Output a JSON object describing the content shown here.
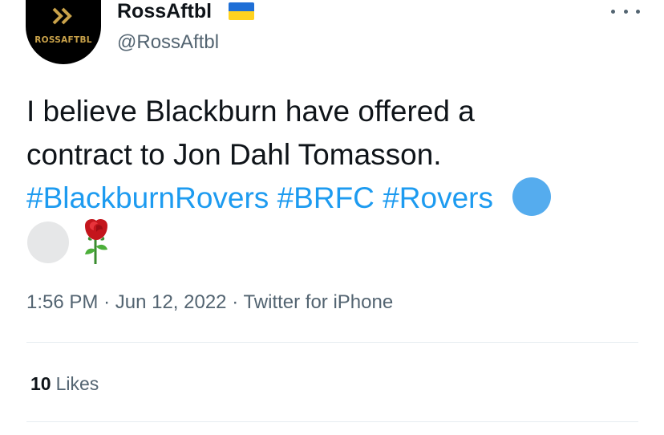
{
  "author": {
    "display_name": "RossAftbl",
    "handle": "@RossAftbl",
    "avatar_text": "ROSSAFTBL",
    "flag_icon": "ukraine-flag-icon"
  },
  "more_icon": "more-options-icon",
  "tweet": {
    "line1": "I believe Blackburn have offered a",
    "line2": "contract to Jon Dahl Tomasson.",
    "hashtags": [
      "#BlackburnRovers",
      "#BRFC",
      "#Rovers"
    ],
    "emojis": [
      "blue-circle-icon",
      "white-circle-icon",
      "rose-icon"
    ]
  },
  "meta": {
    "time": "1:56 PM",
    "date": "Jun 12, 2022",
    "source": "Twitter for iPhone",
    "separator": "·"
  },
  "stats": {
    "likes_count": "10",
    "likes_label": "Likes"
  },
  "colors": {
    "link": "#1d9bf0",
    "secondary_text": "#536471",
    "primary_text": "#0f1419",
    "divider": "#e6ecf0"
  }
}
